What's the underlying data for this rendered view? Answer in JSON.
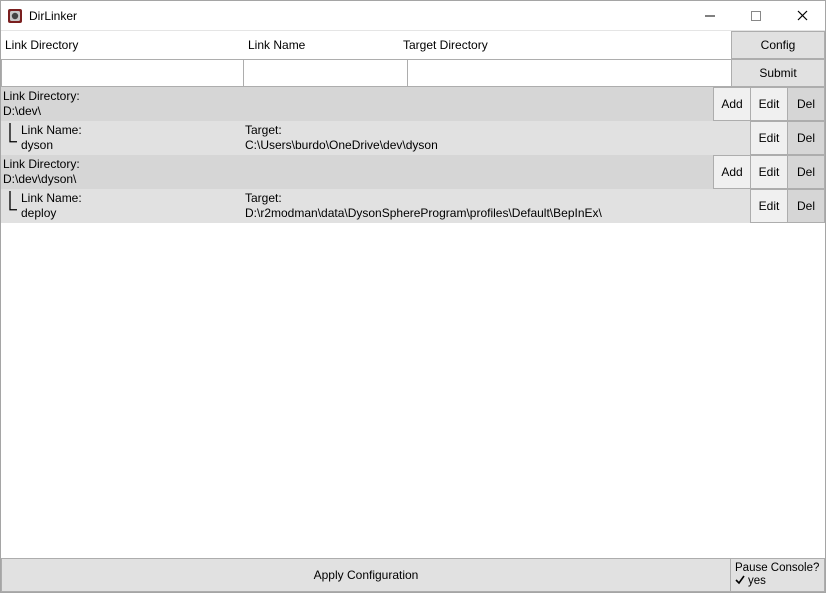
{
  "window": {
    "title": "DirLinker"
  },
  "headers": {
    "link_directory": "Link Directory",
    "link_name": "Link Name",
    "target_directory": "Target Directory"
  },
  "buttons": {
    "config": "Config",
    "submit": "Submit",
    "add": "Add",
    "edit": "Edit",
    "del": "Del",
    "apply": "Apply Configuration"
  },
  "labels": {
    "link_directory_colon": "Link Directory:",
    "link_name_colon": "Link Name:",
    "target_colon": "Target:"
  },
  "inputs": {
    "link_directory": "",
    "link_name": "",
    "target_directory": ""
  },
  "groups": [
    {
      "dir": "D:\\dev\\",
      "items": [
        {
          "name": "dyson",
          "target": "C:\\Users\\burdo\\OneDrive\\dev\\dyson"
        }
      ]
    },
    {
      "dir": "D:\\dev\\dyson\\",
      "items": [
        {
          "name": "deploy",
          "target": "D:\\r2modman\\data\\DysonSphereProgram\\profiles\\Default\\BepInEx\\"
        }
      ]
    }
  ],
  "pause": {
    "label": "Pause Console?",
    "value": "yes"
  }
}
